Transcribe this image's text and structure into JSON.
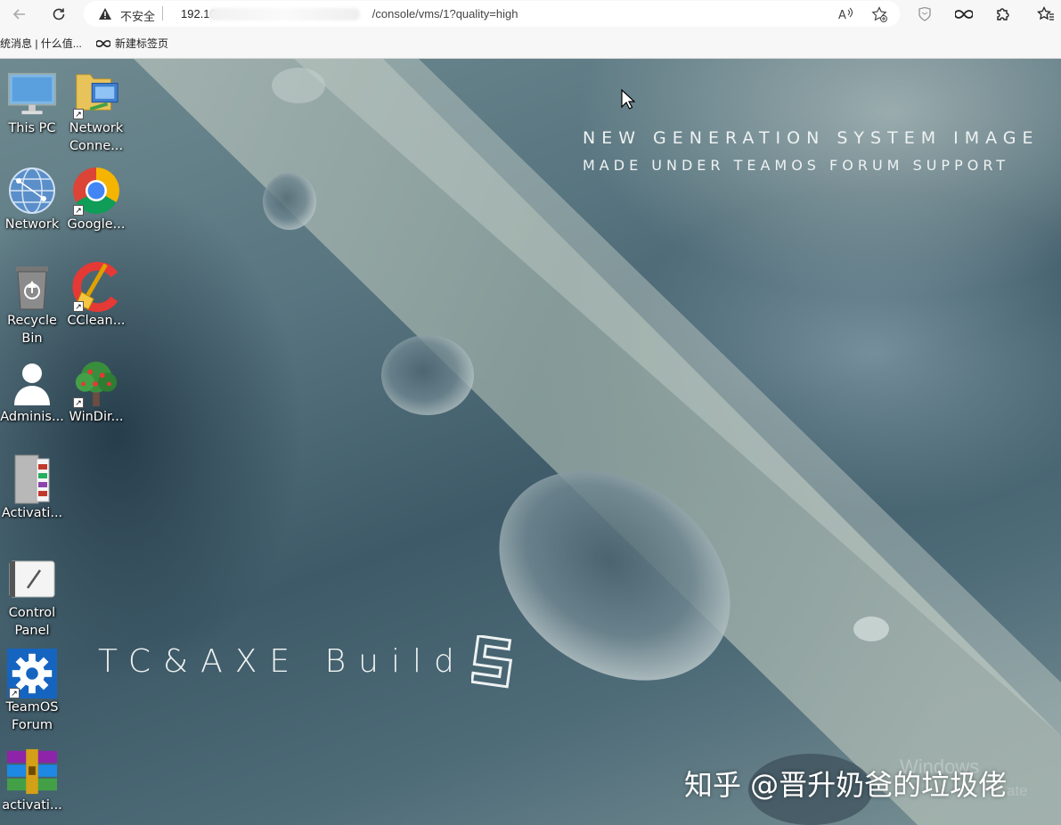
{
  "browser": {
    "address_bar": {
      "security_label": "不安全",
      "url_host": "192.16",
      "url_path": "/console/vms/1?quality=high"
    },
    "icons": {
      "back": "back-arrow-icon",
      "reload": "reload-icon",
      "warning": "warning-triangle-icon",
      "read_aloud": "read-aloud-icon",
      "favorite": "add-favorite-icon",
      "shield": "shield-icon",
      "infinity": "infinity-icon",
      "extensions": "puzzle-icon",
      "favorites": "favorites-icon"
    }
  },
  "bookmarks": [
    {
      "label": "统消息 | 什么值..."
    },
    {
      "label": "新建标签页"
    }
  ],
  "desktop": {
    "headline_1": "NEW GENERATION SYSTEM IMAGE",
    "headline_2": "MADE UNDER TEAMOS FORUM SUPPORT",
    "build_text": "TC&AXE Build",
    "icons": [
      {
        "label": "This PC",
        "icon": "computer-icon"
      },
      {
        "label": "Network Conne...",
        "icon": "network-connections-icon"
      },
      {
        "label": "Network",
        "icon": "network-globe-icon"
      },
      {
        "label": "Google...",
        "icon": "chrome-icon"
      },
      {
        "label": "Recycle Bin",
        "icon": "recycle-bin-icon"
      },
      {
        "label": "CClean...",
        "icon": "ccleaner-icon"
      },
      {
        "label": "Adminis...",
        "icon": "user-icon"
      },
      {
        "label": "WinDir...",
        "icon": "windirstat-tree-icon"
      },
      {
        "label": "Activati...",
        "icon": "activation-folder-icon"
      },
      {
        "label": "Control Panel",
        "icon": "control-panel-icon"
      },
      {
        "label": "TeamOS Forum",
        "icon": "gear-icon"
      },
      {
        "label": "activati...",
        "icon": "winrar-archive-icon"
      }
    ],
    "watermark": "知乎 @晋升奶爸的垃圾佬",
    "activation_text_1": "Windows",
    "activation_text_2": "ate"
  },
  "colors": {
    "toolbar_bg": "#f7f7f7",
    "address_bg": "#ffffff",
    "desktop_teal": "#587580",
    "chrome_red": "#db4437",
    "chrome_green": "#0f9d58",
    "chrome_yellow": "#f4b400",
    "chrome_blue": "#4285f4",
    "teamos_blue": "#1565c0"
  }
}
